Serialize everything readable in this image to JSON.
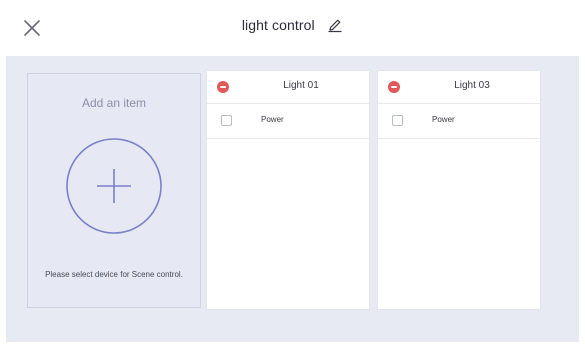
{
  "header": {
    "title": "light control",
    "close_icon": "close-icon",
    "edit_icon": "pencil-icon"
  },
  "add_item": {
    "title": "Add an item",
    "icon": "plus-circle-icon",
    "hint": "Please select device for Scene control."
  },
  "devices": [
    {
      "name": "Light 01",
      "remove_icon": "minus-circle-icon",
      "items": [
        {
          "label": "Power",
          "checked": false
        }
      ]
    },
    {
      "name": "Light 03",
      "remove_icon": "minus-circle-icon",
      "items": [
        {
          "label": "Power",
          "checked": false
        }
      ]
    }
  ],
  "colors": {
    "background": "#e7e9f3",
    "accent": "#7a80c9",
    "remove": "#e25757"
  }
}
